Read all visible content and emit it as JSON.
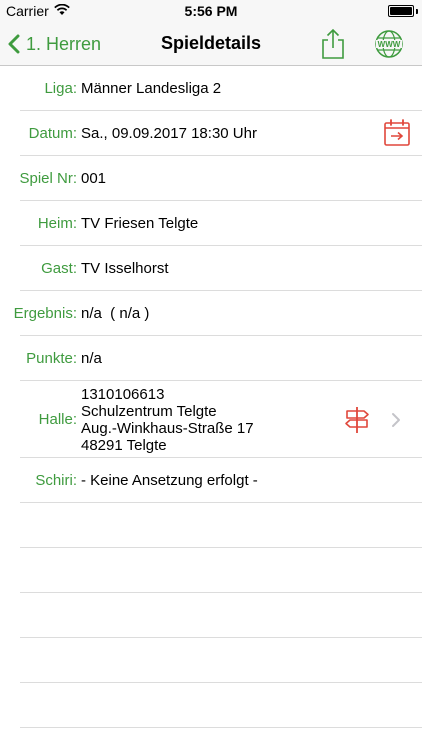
{
  "status_bar": {
    "carrier": "Carrier",
    "time": "5:56 PM",
    "battery_level": 1.0
  },
  "nav": {
    "back_label": "1. Herren",
    "title": "Spieldetails",
    "share_icon": "share-icon",
    "www_icon": "globe-www-icon"
  },
  "details": {
    "liga": {
      "label": "Liga:",
      "value": "Männer Landesliga 2"
    },
    "datum": {
      "label": "Datum:",
      "value": "Sa., 09.09.2017 18:30 Uhr"
    },
    "spiel_nr": {
      "label": "Spiel Nr:",
      "value": "001"
    },
    "heim": {
      "label": "Heim:",
      "value": "TV Friesen Telgte"
    },
    "gast": {
      "label": "Gast:",
      "value": "TV Isselhorst"
    },
    "ergebnis": {
      "label": "Ergebnis:",
      "value": "n/a  ( n/a )"
    },
    "punkte": {
      "label": "Punkte:",
      "value": "n/a"
    },
    "halle": {
      "label": "Halle:",
      "line1": "1310106613",
      "line2": "Schulzentrum Telgte",
      "line3": "Aug.-Winkhaus-Straße 17",
      "line4": "48291 Telgte"
    },
    "schiri": {
      "label": "Schiri:",
      "value": "- Keine Ansetzung erfolgt -"
    }
  },
  "colors": {
    "accent": "#3f9b3f",
    "icon_red": "#e0473b"
  }
}
